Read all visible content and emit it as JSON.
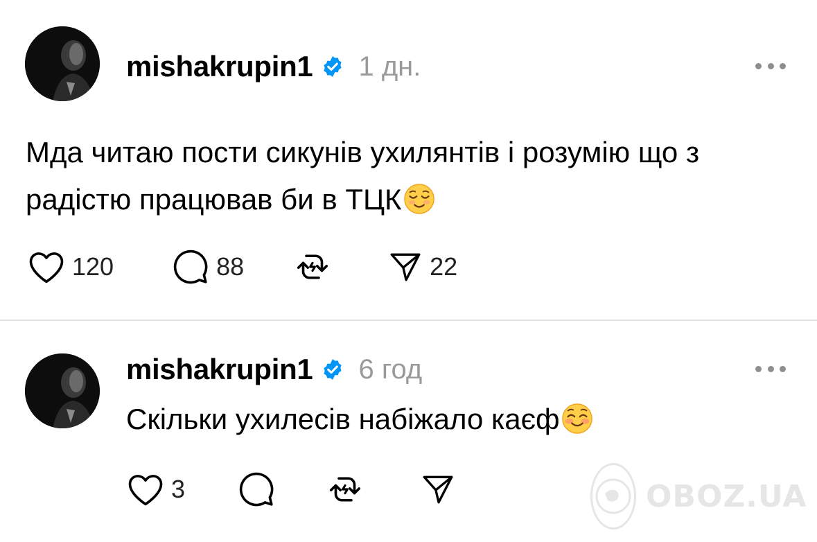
{
  "posts": [
    {
      "username": "mishakrupin1",
      "time": "1 дн.",
      "text": "Мда читаю пости сикунів ухилянтів і розумію що з радістю працював би в ТЦК",
      "text_line1": "Мда читаю пости сикунів ухилянтів і розумію що з",
      "text_line2": "радістю працював би в ТЦК",
      "emoji": "relieved-face",
      "likes": "120",
      "replies": "88",
      "reposts": "",
      "shares": "22"
    },
    {
      "username": "mishakrupin1",
      "time": "6 год",
      "text": "Скільки ухилесів набіжало каєф",
      "emoji": "smiling-face",
      "likes": "3",
      "replies": "",
      "reposts": "",
      "shares": ""
    }
  ],
  "watermark": {
    "text": "OBOZ.UA"
  },
  "colors": {
    "verified": "#0095f6",
    "muted": "#9a9a9a",
    "divider": "#e2e2e2",
    "text": "#000000"
  },
  "icons": [
    "heart-icon",
    "comment-icon",
    "repost-icon",
    "share-icon",
    "verified-badge-icon",
    "more-options-icon"
  ]
}
